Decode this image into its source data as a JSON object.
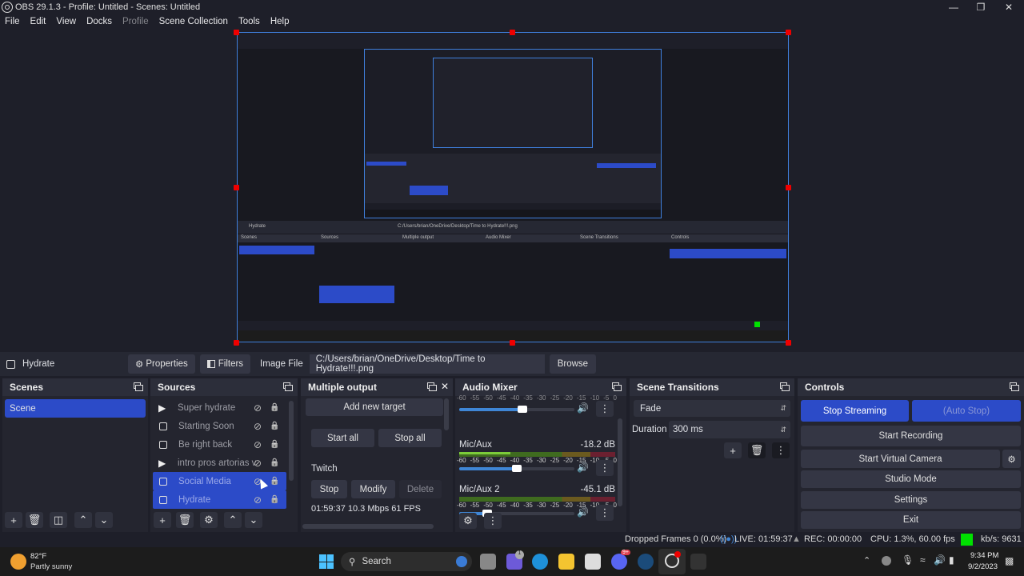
{
  "window": {
    "title": "OBS 29.1.3 - Profile: Untitled - Scenes: Untitled",
    "controls": [
      "minimize",
      "restore",
      "close"
    ]
  },
  "menu": [
    "File",
    "Edit",
    "View",
    "Docks",
    "Profile",
    "Scene Collection",
    "Tools",
    "Help"
  ],
  "menu_disabled": [
    "Profile"
  ],
  "source_toolbar": {
    "selected_source": "Hydrate",
    "properties": "Properties",
    "filters": "Filters",
    "image_file_label": "Image File",
    "image_file_path": "C:/Users/brian/OneDrive/Desktop/Time to Hydrate!!!.png",
    "browse": "Browse"
  },
  "scenes": {
    "title": "Scenes",
    "items": [
      {
        "label": "Scene",
        "selected": true
      }
    ]
  },
  "sources": {
    "title": "Sources",
    "items": [
      {
        "label": "Super hydrate",
        "type": "media",
        "selected": false
      },
      {
        "label": "Starting Soon",
        "type": "image",
        "selected": false
      },
      {
        "label": "Be right back",
        "type": "image",
        "selected": false
      },
      {
        "label": "intro pros artorias ver",
        "type": "media",
        "selected": false
      },
      {
        "label": "Social Media",
        "type": "image",
        "selected": true
      },
      {
        "label": "Hydrate",
        "type": "image",
        "selected": true
      }
    ]
  },
  "multiple_output": {
    "title": "Multiple output",
    "add_new_target": "Add new target",
    "start_all": "Start all",
    "stop_all": "Stop all",
    "target_name": "Twitch",
    "stop": "Stop",
    "modify": "Modify",
    "delete": "Delete",
    "stats": "01:59:37  10.3 Mbps  61 FPS"
  },
  "audio_mixer": {
    "title": "Audio Mixer",
    "scale": [
      "-60",
      "-55",
      "-50",
      "-45",
      "-40",
      "-35",
      "-30",
      "-25",
      "-20",
      "-15",
      "-10",
      "-5",
      "0"
    ],
    "channels": [
      {
        "name": "",
        "db": "",
        "volume_fraction": 0.55,
        "level_fraction": 0
      },
      {
        "name": "Mic/Aux",
        "db": "-18.2 dB",
        "volume_fraction": 0.5,
        "level_fraction": 0.33
      },
      {
        "name": "Mic/Aux 2",
        "db": "-45.1 dB",
        "volume_fraction": 0.24,
        "level_fraction": 0.0
      }
    ]
  },
  "scene_transitions": {
    "title": "Scene Transitions",
    "transition": "Fade",
    "duration_label": "Duration",
    "duration": "300 ms"
  },
  "controls": {
    "title": "Controls",
    "stop_streaming": "Stop Streaming",
    "auto_stop": "(Auto Stop)",
    "start_recording": "Start Recording",
    "start_virtual_camera": "Start Virtual Camera",
    "studio_mode": "Studio Mode",
    "settings": "Settings",
    "exit": "Exit"
  },
  "status_bar": {
    "dropped_frames": "Dropped Frames 0 (0.0%)",
    "live": "LIVE: 01:59:37",
    "rec": "REC: 00:00:00",
    "cpu": "CPU: 1.3%, 60.00 fps",
    "kbps": "kb/s: 9631",
    "health_color": "#00e000"
  },
  "taskbar": {
    "weather_temp": "82°F",
    "weather_desc": "Partly sunny",
    "search_placeholder": "Search",
    "time": "9:34 PM",
    "date": "9/2/2023",
    "badges": {
      "teams": "1",
      "discord": "9+"
    }
  },
  "colors": {
    "accent": "#2c4bc8",
    "panel": "#24252f",
    "button": "#343644",
    "selection_border": "#3f7fdc"
  }
}
